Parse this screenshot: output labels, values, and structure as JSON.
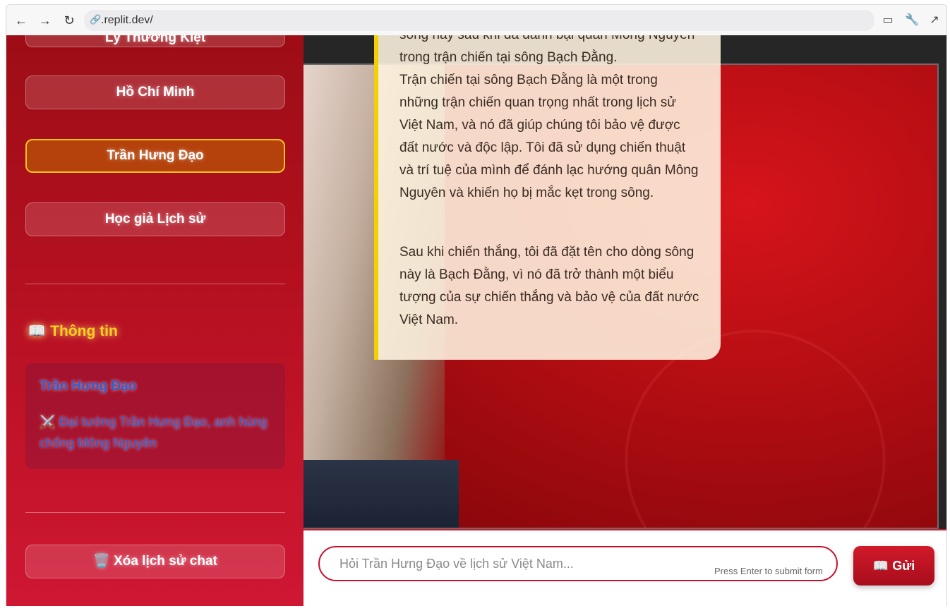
{
  "browser": {
    "url": ".replit.dev/"
  },
  "sidebar": {
    "partial_item": "Lý Thường Kiệt",
    "items": [
      {
        "label": "Hồ Chí Minh"
      },
      {
        "label": "Trần Hưng Đạo"
      },
      {
        "label": "Học giả Lịch sử"
      }
    ],
    "info_title": "Thông tin",
    "info_name": "Trần Hưng Đạo",
    "info_icon": "⚔️",
    "info_desc": "Đại tướng Trần Hưng Đạo, anh hùng chống Mông Nguyên",
    "clear_icon": "🗑️",
    "clear_label": "Xóa lịch sử chat"
  },
  "chat": {
    "message_cut": "sông này sau khi đã đánh bại quân Mông Nguyên",
    "message_line2": "trong trận chiến tại sông Bạch Đằng.",
    "message_p2": "Trận chiến tại sông Bạch Đằng là một trong những trận chiến quan trọng nhất trong lịch sử Việt Nam, và nó đã giúp chúng tôi bảo vệ được đất nước và độc lập. Tôi đã sử dụng chiến thuật và trí tuệ của mình để đánh lạc hướng quân Mông Nguyên và khiến họ bị mắc kẹt trong sông.",
    "message_p3": "Sau khi chiến thắng, tôi đã đặt tên cho dòng sông này là Bạch Đằng, vì nó đã trở thành một biểu tượng của sự chiến thắng và bảo vệ của đất nước Việt Nam."
  },
  "input": {
    "placeholder": "Hỏi Trần Hưng Đạo về lịch sử Việt Nam...",
    "hint": "Press Enter to submit form",
    "send_icon": "📖",
    "send_label": "Gửi"
  }
}
